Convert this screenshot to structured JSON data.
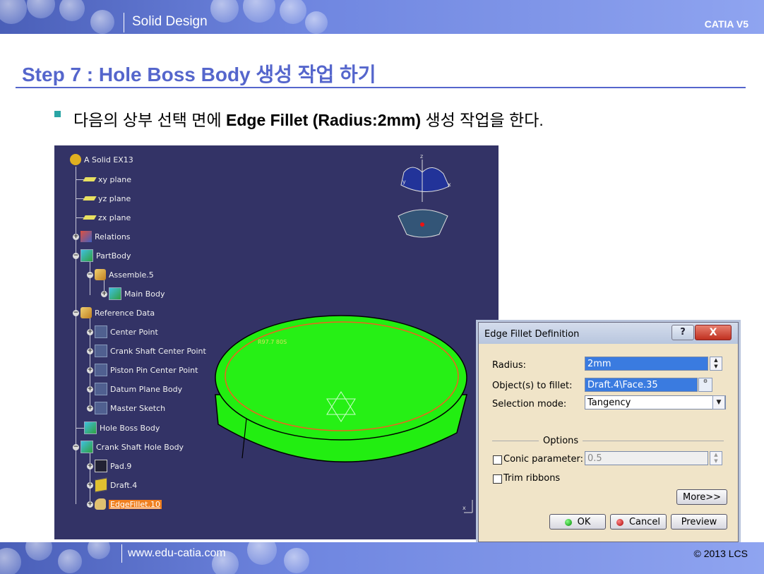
{
  "header": {
    "title": "Solid Design",
    "product": "CATIA V5"
  },
  "slide": {
    "step_title": "Step 7 : Hole Boss Body 생성 작업 하기",
    "instruction_pre": "다음의 상부 선택 면에 ",
    "instruction_bold": "Edge Fillet (Radius:2mm)",
    "instruction_post": " 생성 작업을 한다."
  },
  "tree": {
    "root": "A Solid EX13",
    "xy": "xy plane",
    "yz": "yz plane",
    "zx": "zx plane",
    "relations": "Relations",
    "partbody": "PartBody",
    "assemble": "Assemble.5",
    "mainbody": "Main Body",
    "refdata": "Reference Data",
    "center": "Center Point",
    "crank_center": "Crank Shaft Center Point",
    "piston_center": "Piston Pin Center Point",
    "datum": "Datum Plane Body",
    "master": "Master Sketch",
    "holeboss": "Hole Boss Body",
    "crank_hole": "Crank Shaft Hole Body",
    "pad": "Pad.9",
    "draft": "Draft.4",
    "fillet": "EdgeFillet.10"
  },
  "model": {
    "face_tag": "R97.7 80S",
    "axis_z": "z",
    "axis_y": "y",
    "axis_x": "x"
  },
  "dialog": {
    "title": "Edge Fillet Definition",
    "help": "?",
    "close": "X",
    "radius_label": "Radius:",
    "radius_value": "2mm",
    "objects_label": "Object(s) to fillet:",
    "objects_value": "Draft.4\\Face.35",
    "mode_label": "Selection mode:",
    "mode_value": "Tangency",
    "options_label": "Options",
    "conic_label": "Conic parameter:",
    "conic_value": "0.5",
    "trim_label": "Trim ribbons",
    "more": "More>>",
    "ok": "OK",
    "cancel": "Cancel",
    "preview": "Preview"
  },
  "footer": {
    "url": "www.edu-catia.com",
    "copyright": "© 2013 LCS"
  },
  "colors": {
    "accent": "#5566cc",
    "viewport": "#333366",
    "model": "#22ee11",
    "highlight": "#f08020"
  }
}
